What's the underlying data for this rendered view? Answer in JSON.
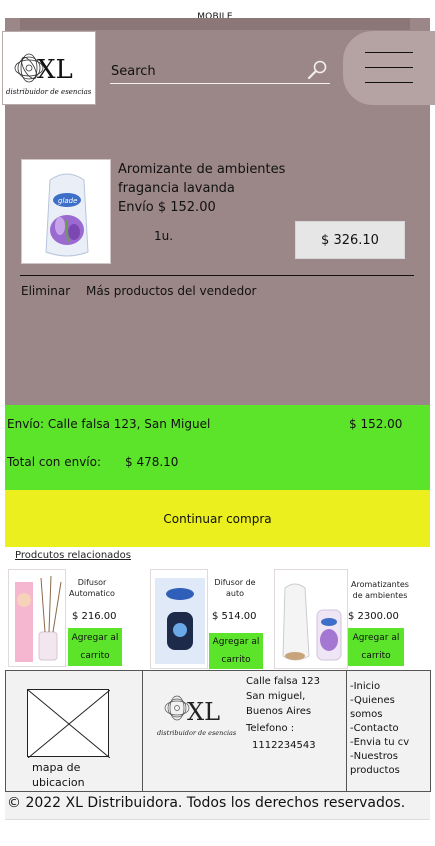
{
  "page": {
    "label": "MOBILE"
  },
  "header": {
    "logo_alt": "XL distribuidor de esencias",
    "search_placeholder": "Search"
  },
  "cart_item": {
    "title": "Aromizante  de ambientes fragancia lavanda",
    "shipping": "Envío $ 152.00",
    "quantity": "1u.",
    "price": "$ 326.10",
    "remove_label": "Eliminar",
    "more_label": "Más productos del vendedor"
  },
  "summary": {
    "shipping_address": "Envío: Calle falsa 123, San Miguel",
    "shipping_cost": "$ 152.00",
    "total_label": "Total con envío:",
    "total_value": "$ 478.10",
    "continue_label": "Continuar compra"
  },
  "related": {
    "title": "Prodcutos relacionados",
    "items": [
      {
        "name": "Difusor Automatico",
        "price": "$ 216.00",
        "button": "Agregar al carrito"
      },
      {
        "name": "Difusor de auto",
        "price": "$ 514.00",
        "button": "Agregar al carrito"
      },
      {
        "name": "Aromatizantes de ambientes",
        "price": "$ 2300.00",
        "button": "Agregar al carrito"
      }
    ]
  },
  "footer": {
    "map_label": "mapa de ubicacion",
    "address": "Calle falsa 123 San miguel, Buenos Aires",
    "phone_label": "Telefono :",
    "phone": "1112234543",
    "links": [
      "-Inicio",
      "-Quienes somos",
      "-Contacto",
      "-Envia tu cv",
      "-Nuestros productos"
    ],
    "copyright": "© 2022 XL Distribuidora. Todos los derechos reservados."
  },
  "colors": {
    "panel": "#9c8788",
    "menu_pill": "#b5a3a4",
    "summary_green": "#5ce42a",
    "continue_yellow": "#eaef1d"
  },
  "icons": [
    "search-icon",
    "hamburger-menu-icon",
    "logo-icon"
  ]
}
